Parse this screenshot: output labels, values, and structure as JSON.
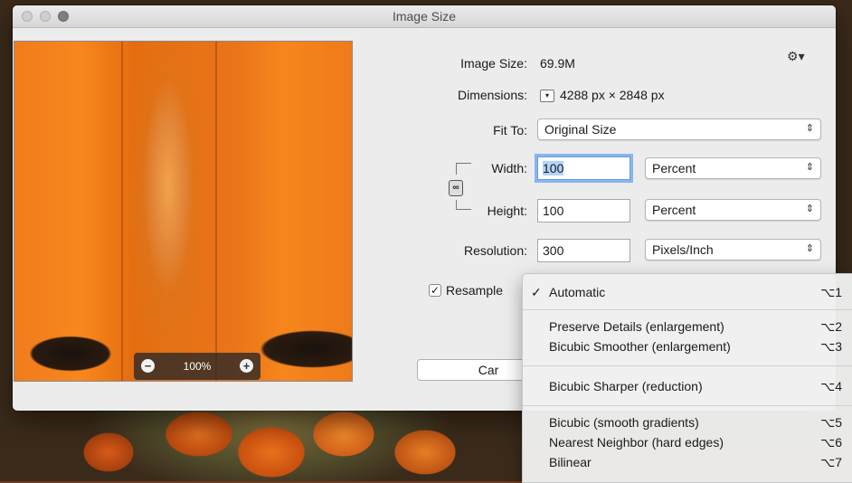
{
  "window": {
    "title": "Image Size"
  },
  "preview": {
    "zoom_label": "100%",
    "zoom_out": "−",
    "zoom_in": "+"
  },
  "info": {
    "image_size_label": "Image Size:",
    "image_size_value": "69.9M",
    "dimensions_label": "Dimensions:",
    "dimensions_value": "4288 px  ×  2848 px"
  },
  "fit_to": {
    "label": "Fit To:",
    "value": "Original Size"
  },
  "width": {
    "label": "Width:",
    "value": "100",
    "unit": "Percent"
  },
  "height": {
    "label": "Height:",
    "value": "100",
    "unit": "Percent"
  },
  "resolution": {
    "label": "Resolution:",
    "value": "300",
    "unit": "Pixels/Inch"
  },
  "resample": {
    "label": "Resample",
    "checked": "✓"
  },
  "buttons": {
    "cancel": "Car"
  },
  "icons": {
    "gear": "⚙",
    "select_arrows": "⇕",
    "chain": "link-icon"
  },
  "menu": {
    "items": [
      {
        "label": "Automatic",
        "shortcut": "⌥1",
        "checked": "✓"
      },
      {
        "label": "Preserve Details (enlargement)",
        "shortcut": "⌥2"
      },
      {
        "label": "Bicubic Smoother (enlargement)",
        "shortcut": "⌥3"
      },
      {
        "label": "Bicubic Sharper (reduction)",
        "shortcut": "⌥4"
      },
      {
        "label": "Bicubic (smooth gradients)",
        "shortcut": "⌥5"
      },
      {
        "label": "Nearest Neighbor (hard edges)",
        "shortcut": "⌥6"
      },
      {
        "label": "Bilinear",
        "shortcut": "⌥7"
      }
    ]
  },
  "colors": {
    "focus_ring": "#87b5ef",
    "selection": "#b4d3fb"
  }
}
